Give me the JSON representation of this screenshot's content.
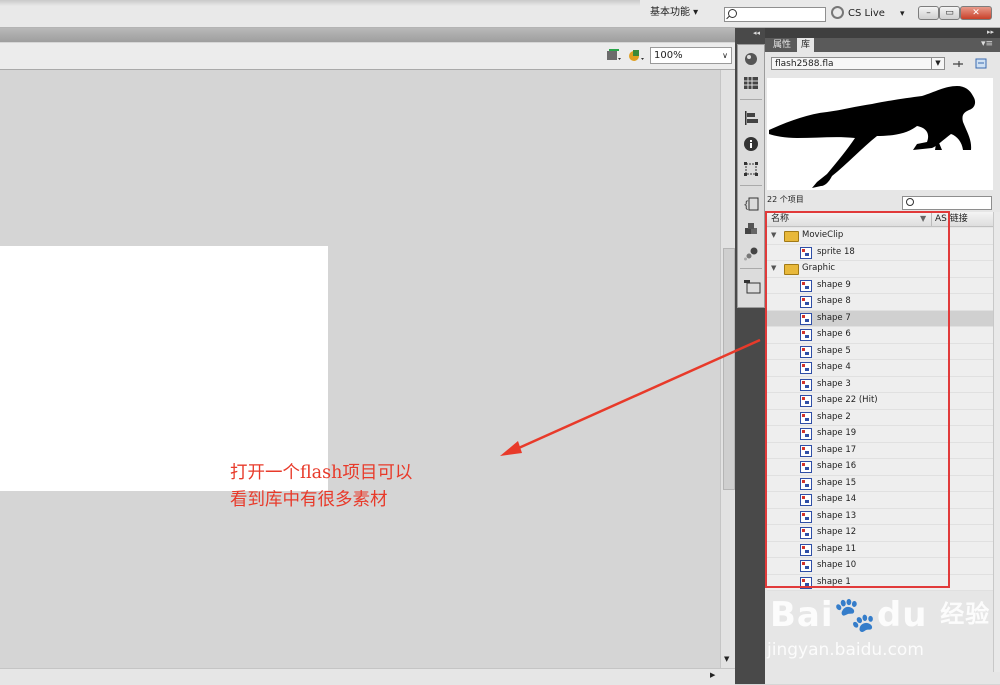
{
  "topbar": {
    "workspace_label": "基本功能 ▾",
    "cslive_label": "CS Live",
    "cslive_arrow": "▾",
    "window_buttons": {
      "minimize": "–",
      "maximize": "▭",
      "close": "✕"
    }
  },
  "editbar": {
    "zoom_value": "100%",
    "zoom_arrow": "∨"
  },
  "panel": {
    "tabs": [
      {
        "label": "属性"
      },
      {
        "label": "库"
      }
    ],
    "file_select_value": "flash2588.fla",
    "item_count": "22 个项目",
    "column_headers": {
      "name": "名称",
      "linkage": "AS 链接"
    },
    "items": [
      {
        "label": "MovieClip",
        "type": "folder",
        "expanded": true
      },
      {
        "label": "sprite 18",
        "type": "symbol",
        "child": true
      },
      {
        "label": "Graphic",
        "type": "folder",
        "expanded": true
      },
      {
        "label": "shape 9",
        "type": "symbol",
        "child": true
      },
      {
        "label": "shape 8",
        "type": "symbol",
        "child": true
      },
      {
        "label": "shape 7",
        "type": "symbol",
        "child": true,
        "selected": true
      },
      {
        "label": "shape 6",
        "type": "symbol",
        "child": true
      },
      {
        "label": "shape 5",
        "type": "symbol",
        "child": true
      },
      {
        "label": "shape 4",
        "type": "symbol",
        "child": true
      },
      {
        "label": "shape 3",
        "type": "symbol",
        "child": true
      },
      {
        "label": "shape 22 (Hit)",
        "type": "symbol",
        "child": true
      },
      {
        "label": "shape 2",
        "type": "symbol",
        "child": true
      },
      {
        "label": "shape 19",
        "type": "symbol",
        "child": true
      },
      {
        "label": "shape 17",
        "type": "symbol",
        "child": true
      },
      {
        "label": "shape 16",
        "type": "symbol",
        "child": true
      },
      {
        "label": "shape 15",
        "type": "symbol",
        "child": true
      },
      {
        "label": "shape 14",
        "type": "symbol",
        "child": true
      },
      {
        "label": "shape 13",
        "type": "symbol",
        "child": true
      },
      {
        "label": "shape 12",
        "type": "symbol",
        "child": true
      },
      {
        "label": "shape 11",
        "type": "symbol",
        "child": true
      },
      {
        "label": "shape 10",
        "type": "symbol",
        "child": true
      },
      {
        "label": "shape 1",
        "type": "symbol",
        "child": true
      }
    ]
  },
  "annotation": {
    "line1": "打开一个flash项目可以",
    "line2": "看到库中有很多素材",
    "color": "#e83a2a"
  },
  "watermark": {
    "logo": "Bai",
    "logo2": "du",
    "logo_cn": "经验",
    "url": "jingyan.baidu.com"
  },
  "icons": [
    "magnifier-icon",
    "cs-live-icon",
    "scene-icon",
    "symbol-icon",
    "color-icon",
    "swatches-icon",
    "align-icon",
    "info-icon",
    "transform-icon",
    "code-snippets-icon",
    "components-icon",
    "motion-presets-icon",
    "project-icon",
    "new-symbol-icon",
    "new-folder-icon",
    "panel-menu-icon"
  ]
}
